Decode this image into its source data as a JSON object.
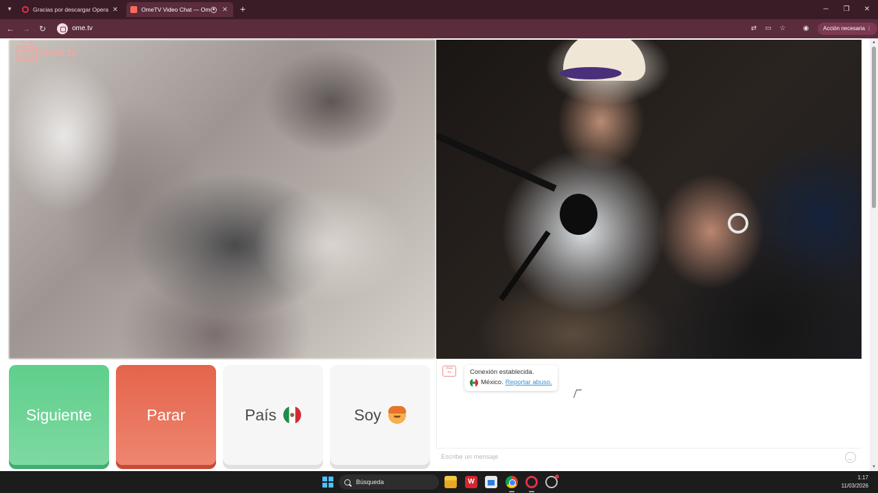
{
  "browser": {
    "tabs": [
      {
        "title": "Gracias por descargar Opera",
        "active": false
      },
      {
        "title": "OmeTV Video Chat — Ome",
        "active": true
      }
    ],
    "url": "ome.tv",
    "action_pill": "Acción necesaria"
  },
  "brand": {
    "logo_tv_text": "Ome TV",
    "name": "Ome.tv"
  },
  "buttons": {
    "next": "Siguiente",
    "stop": "Parar",
    "country": "País",
    "country_icon": "mexico-flag-icon",
    "gender": "Soy",
    "gender_icon": "boy-face-emoji-icon"
  },
  "chat": {
    "status": "Conexión establecida.",
    "country": "México.",
    "report_link": "Reportar abuso.",
    "input_placeholder": "Escribe un mensaje"
  },
  "taskbar": {
    "search_label": "Búsqueda",
    "time": "1:17",
    "date": "11/03/2026"
  },
  "colors": {
    "next_green": "#5fcf8c",
    "stop_red": "#e4644b",
    "brand_pink": "#f0a8a2",
    "chrome_bg": "#5a2c3c",
    "link_blue": "#3b8fd0"
  }
}
